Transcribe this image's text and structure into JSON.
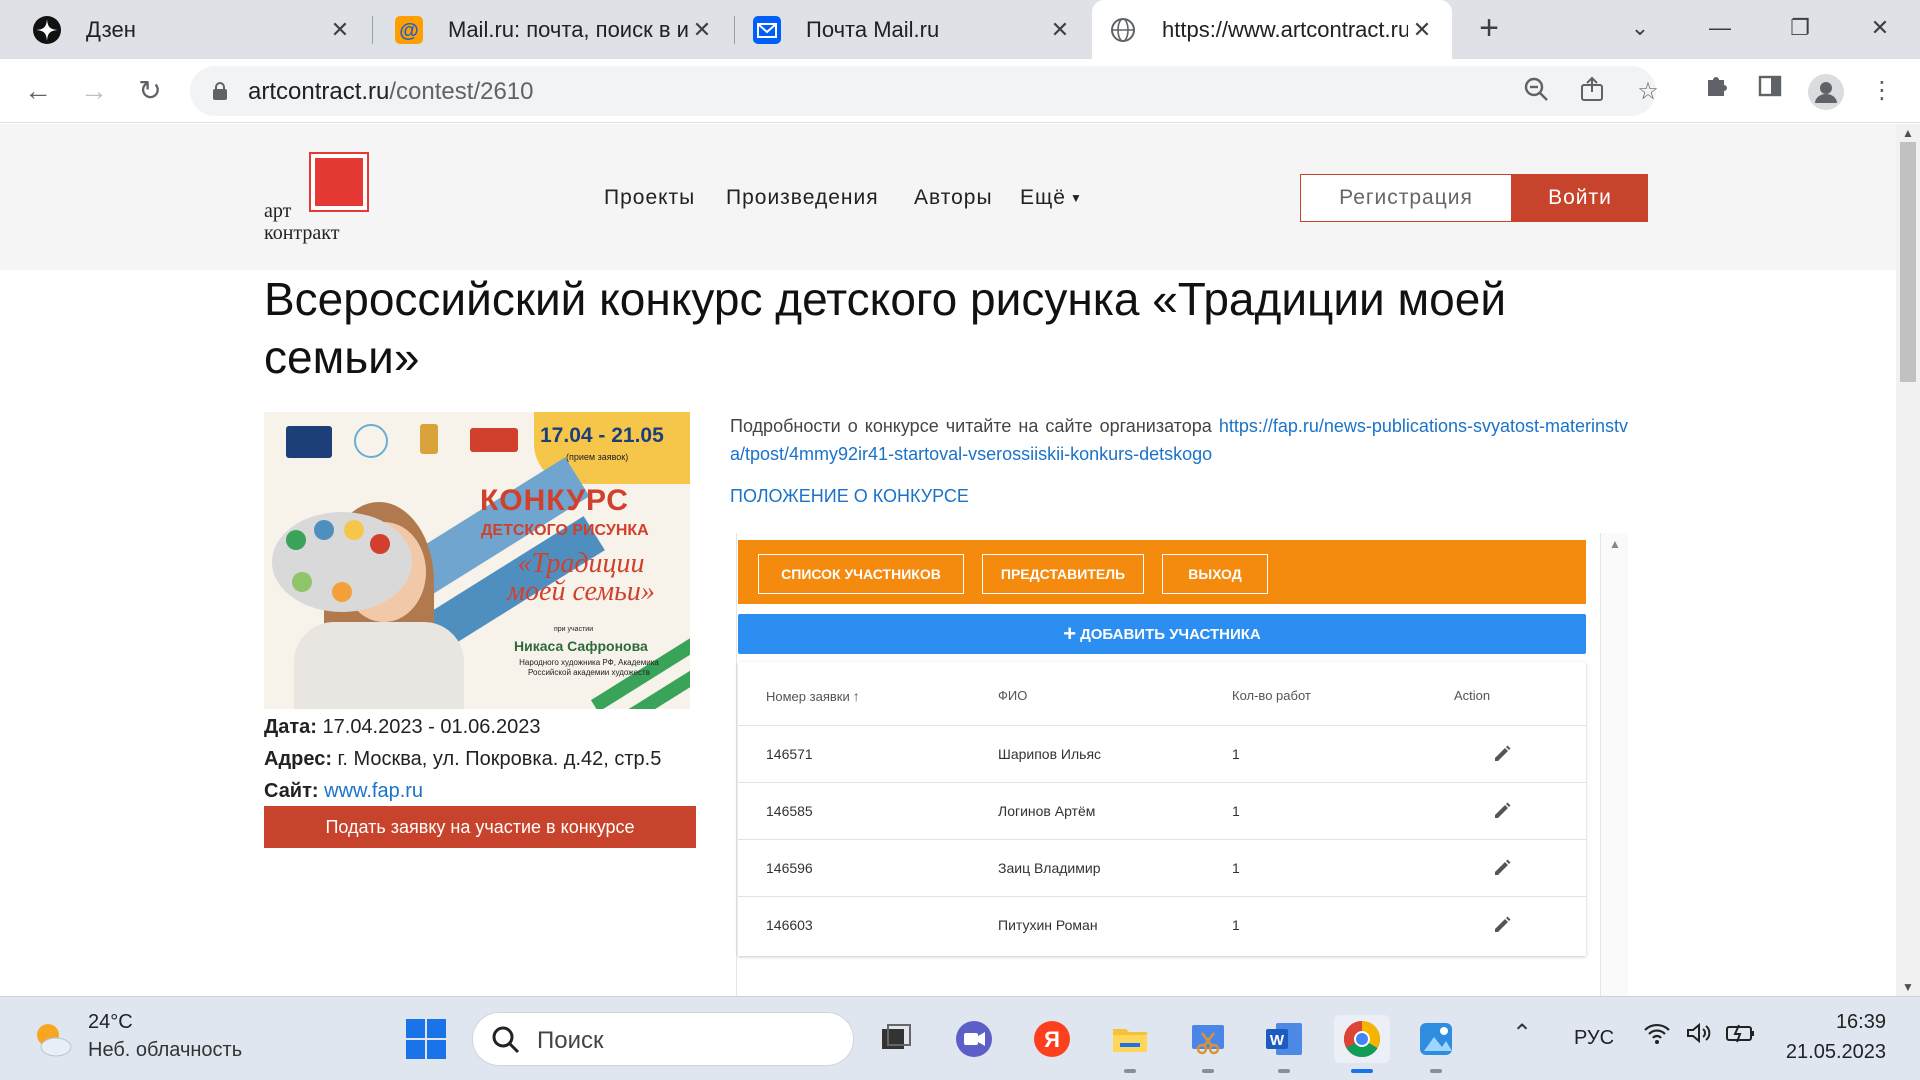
{
  "browser": {
    "tabs": [
      {
        "title": "Дзен",
        "icon": "zen-icon"
      },
      {
        "title": "Mail.ru: почта, поиск в ин",
        "icon": "mailru-at-icon"
      },
      {
        "title": "Почта Mail.ru",
        "icon": "mail-envelope-icon"
      },
      {
        "title": "https://www.artcontract.ru/",
        "icon": "globe-icon",
        "active": true
      }
    ],
    "url_host": "artcontract.ru",
    "url_path": "/contest/2610"
  },
  "site": {
    "logo_line1": "арт",
    "logo_line2": "контракт",
    "nav": [
      "Проекты",
      "Произведения",
      "Авторы",
      "Ещё"
    ],
    "register_label": "Регистрация",
    "login_label": "Войти",
    "accent_color": "#c8432b"
  },
  "contest": {
    "title": "Всероссийский конкурс детского рисунка «Традиции моей семьи»",
    "poster": {
      "dates": "17.04 - 21.05",
      "dates_sub": "(прием заявок)",
      "headline1": "КОНКУРС",
      "headline2": "ДЕТСКОГО РИСУНКА",
      "headline3": "«Традиции моей семьи»",
      "with": "при участии",
      "person": "Никаса Сафронова",
      "person_title": "Народного художника РФ, Академика Российской академии художеств"
    },
    "date_label": "Дата:",
    "date_value": " 17.04.2023 - 01.06.2023",
    "address_label": "Адрес:",
    "address_value": " г. Москва, ул. Покровка. д.42, стр.5",
    "site_label": "Сайт:",
    "site_value": "www.fap.ru",
    "apply_label": "Подать заявку на участие в конкурсе",
    "description": "Подробности о конкурсе читайте на сайте организатора ",
    "organizer_link": "https://fap.ru/news-publications-svyatost-materinstva/tpost/4mmy92ir41-startoval-vserossiiskii-konkurs-detskogo",
    "rules_link": "ПОЛОЖЕНИЕ О КОНКУРСЕ"
  },
  "app": {
    "buttons": [
      "СПИСОК УЧАСТНИКОВ",
      "ПРЕДСТАВИТЕЛЬ",
      "ВЫХОД"
    ],
    "add_label": "ДОБАВИТЬ УЧАСТНИКА",
    "columns": [
      "Номер заявки",
      "ФИО",
      "Кол-во работ",
      "Action"
    ],
    "sort_indicator": "↑",
    "rows": [
      {
        "id": "146571",
        "name": "Шарипов Ильяс",
        "count": "1"
      },
      {
        "id": "146585",
        "name": "Логинов Артём",
        "count": "1"
      },
      {
        "id": "146596",
        "name": "Заиц Владимир",
        "count": "1"
      },
      {
        "id": "146603",
        "name": "Питухин Роман",
        "count": "1"
      }
    ],
    "orange_color": "#f48a0e",
    "blue_color": "#2b8ef0"
  },
  "taskbar": {
    "temperature": "24°C",
    "weather": "Неб. облачность",
    "search_placeholder": "Поиск",
    "language": "РУС",
    "time": "16:39",
    "date": "21.05.2023"
  }
}
